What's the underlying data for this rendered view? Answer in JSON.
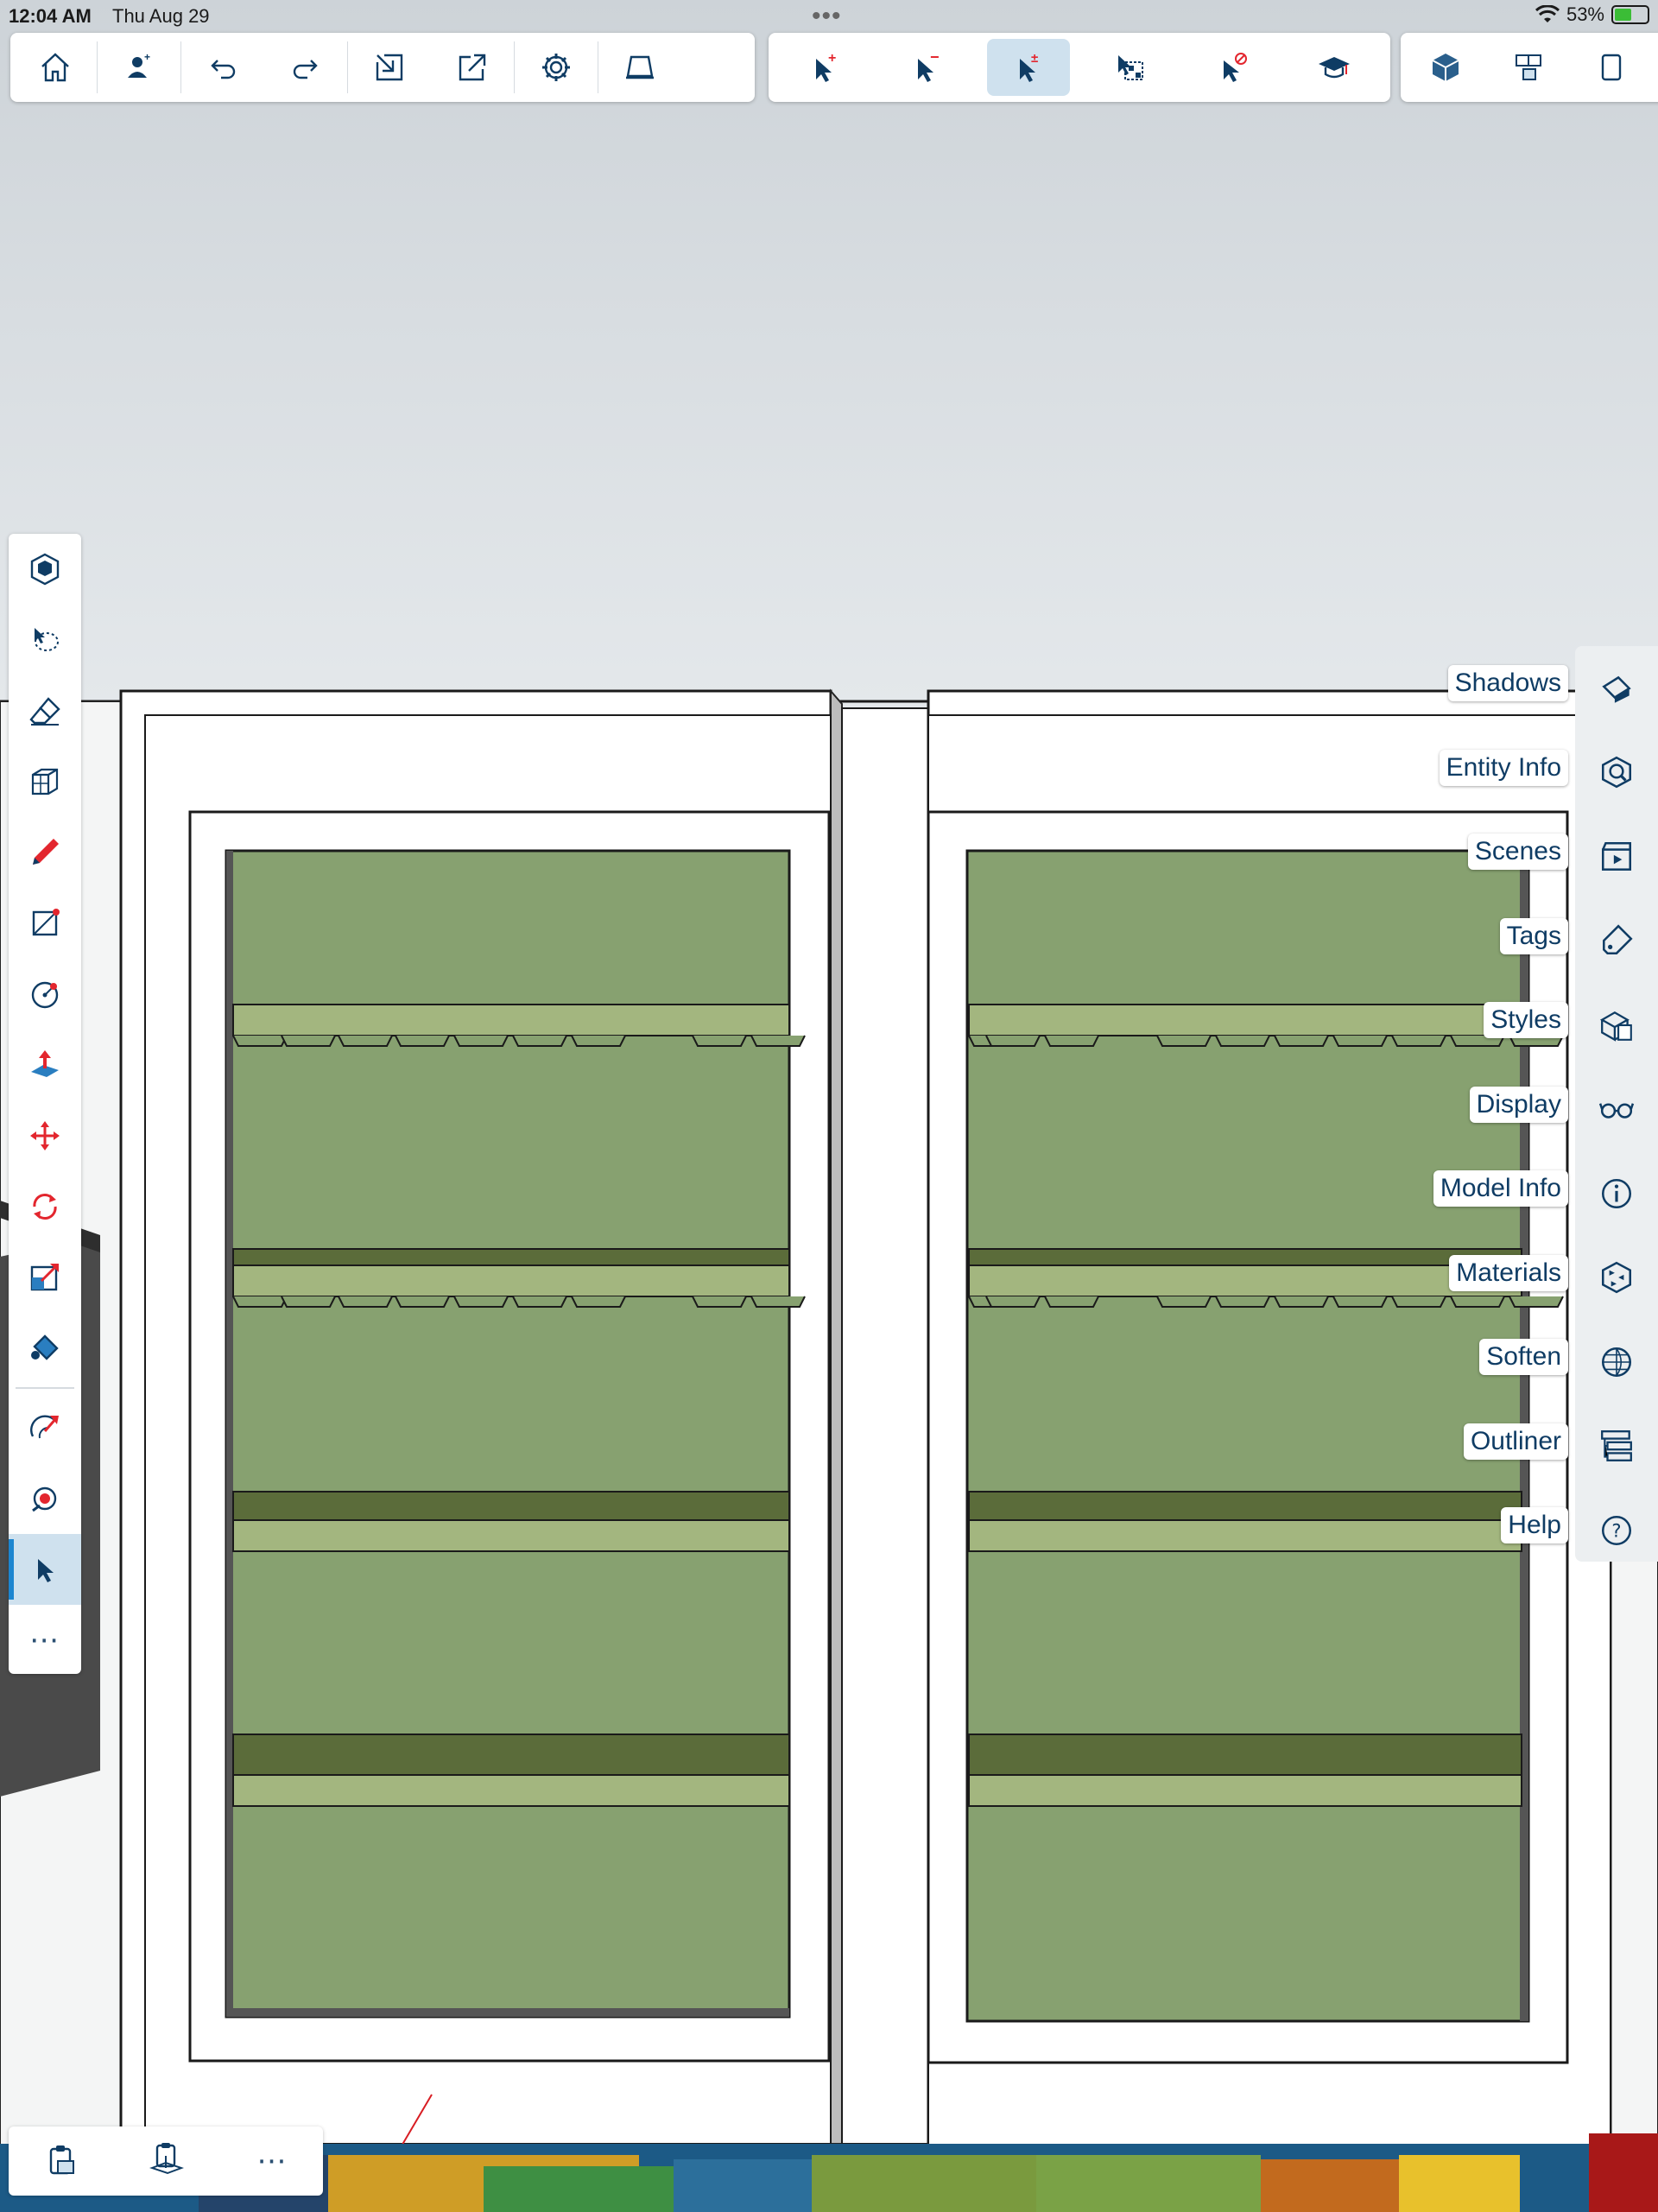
{
  "status_bar": {
    "time": "12:04 AM",
    "date": "Thu Aug 29",
    "battery": "53%"
  },
  "top_toolbar": {
    "group1": [
      "home-icon",
      "add-person-icon",
      "undo-icon",
      "redo-icon",
      "import-icon",
      "export-icon",
      "settings-icon",
      "eraser-paper-icon"
    ],
    "group2": [
      "select-add-icon",
      "select-subtract-icon",
      "select-toggle-icon",
      "select-window-icon",
      "select-none-icon",
      "instructor-icon"
    ],
    "group3": [
      "component-icon",
      "components-icon",
      "library-icon"
    ],
    "active_tool": "select-toggle-icon"
  },
  "left_toolbar": {
    "tools": [
      "views-icon",
      "lasso-icon",
      "eraser-icon",
      "push-pull-box-icon",
      "pencil-icon",
      "rectangle-icon",
      "circle-icon",
      "push-pull-icon",
      "move-icon",
      "rotate-icon",
      "scale-icon",
      "paint-bucket-icon",
      "follow-me-icon",
      "tape-measure-icon",
      "select-arrow-icon"
    ],
    "more_label": "⋯",
    "active_tool": "select-arrow-icon"
  },
  "bottom_bar": {
    "items": [
      "clipboard-icon",
      "paste-in-place-icon"
    ],
    "more_label": "⋯"
  },
  "right_panel": {
    "items": [
      {
        "label": "Shadows",
        "icon": "shadows-icon"
      },
      {
        "label": "Entity Info",
        "icon": "entity-info-icon"
      },
      {
        "label": "Scenes",
        "icon": "scenes-icon"
      },
      {
        "label": "Tags",
        "icon": "tags-icon"
      },
      {
        "label": "Styles",
        "icon": "styles-icon"
      },
      {
        "label": "Display",
        "icon": "display-icon"
      },
      {
        "label": "Model Info",
        "icon": "model-info-icon"
      },
      {
        "label": "Materials",
        "icon": "materials-icon"
      },
      {
        "label": "Soften",
        "icon": "soften-icon"
      },
      {
        "label": "Outliner",
        "icon": "outliner-icon"
      },
      {
        "label": "Help",
        "icon": "help-icon"
      }
    ]
  },
  "colors": {
    "accent": "#1d86d0",
    "icon": "#0f3c64",
    "red": "#e3262e",
    "shelf_back": "#87a170",
    "shelf_light": "#a3b67f",
    "shelf_dark": "#5b6c3a"
  }
}
